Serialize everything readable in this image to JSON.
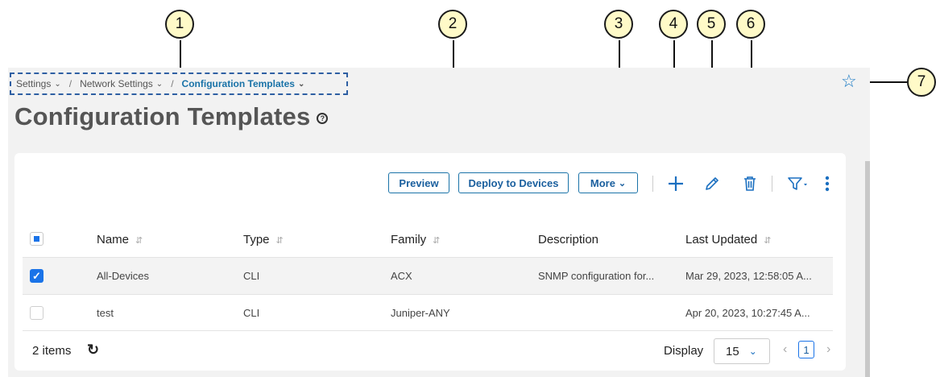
{
  "callouts": [
    "1",
    "2",
    "3",
    "4",
    "5",
    "6",
    "7"
  ],
  "breadcrumb": {
    "items": [
      "Settings",
      "Network Settings",
      "Configuration Templates"
    ],
    "separator": "/"
  },
  "page": {
    "title": "Configuration Templates"
  },
  "toolbar": {
    "preview_label": "Preview",
    "deploy_label": "Deploy to Devices",
    "more_label": "More"
  },
  "icons": {
    "add": "plus-icon",
    "edit": "pencil-icon",
    "delete": "trash-icon",
    "filter": "filter-icon",
    "more": "kebab-icon",
    "favorite": "star-icon",
    "help": "help-icon",
    "refresh": "refresh-icon"
  },
  "table": {
    "columns": [
      "Name",
      "Type",
      "Family",
      "Description",
      "Last Updated"
    ],
    "rows": [
      {
        "name": "All-Devices",
        "type": "CLI",
        "family": "ACX",
        "description": "SNMP configuration for...",
        "updated": "Mar 29, 2023, 12:58:05 A...",
        "checked": true
      },
      {
        "name": "test",
        "type": "CLI",
        "family": "Juniper-ANY",
        "description": "",
        "updated": "Apr 20, 2023, 10:27:45 A...",
        "checked": false
      }
    ]
  },
  "footer": {
    "count": "2 items",
    "display_label": "Display",
    "page_size": "15",
    "current_page": "1"
  },
  "colors": {
    "accent": "#1a73e8",
    "link": "#1a73a8",
    "callout_fill": "#fffac8"
  }
}
